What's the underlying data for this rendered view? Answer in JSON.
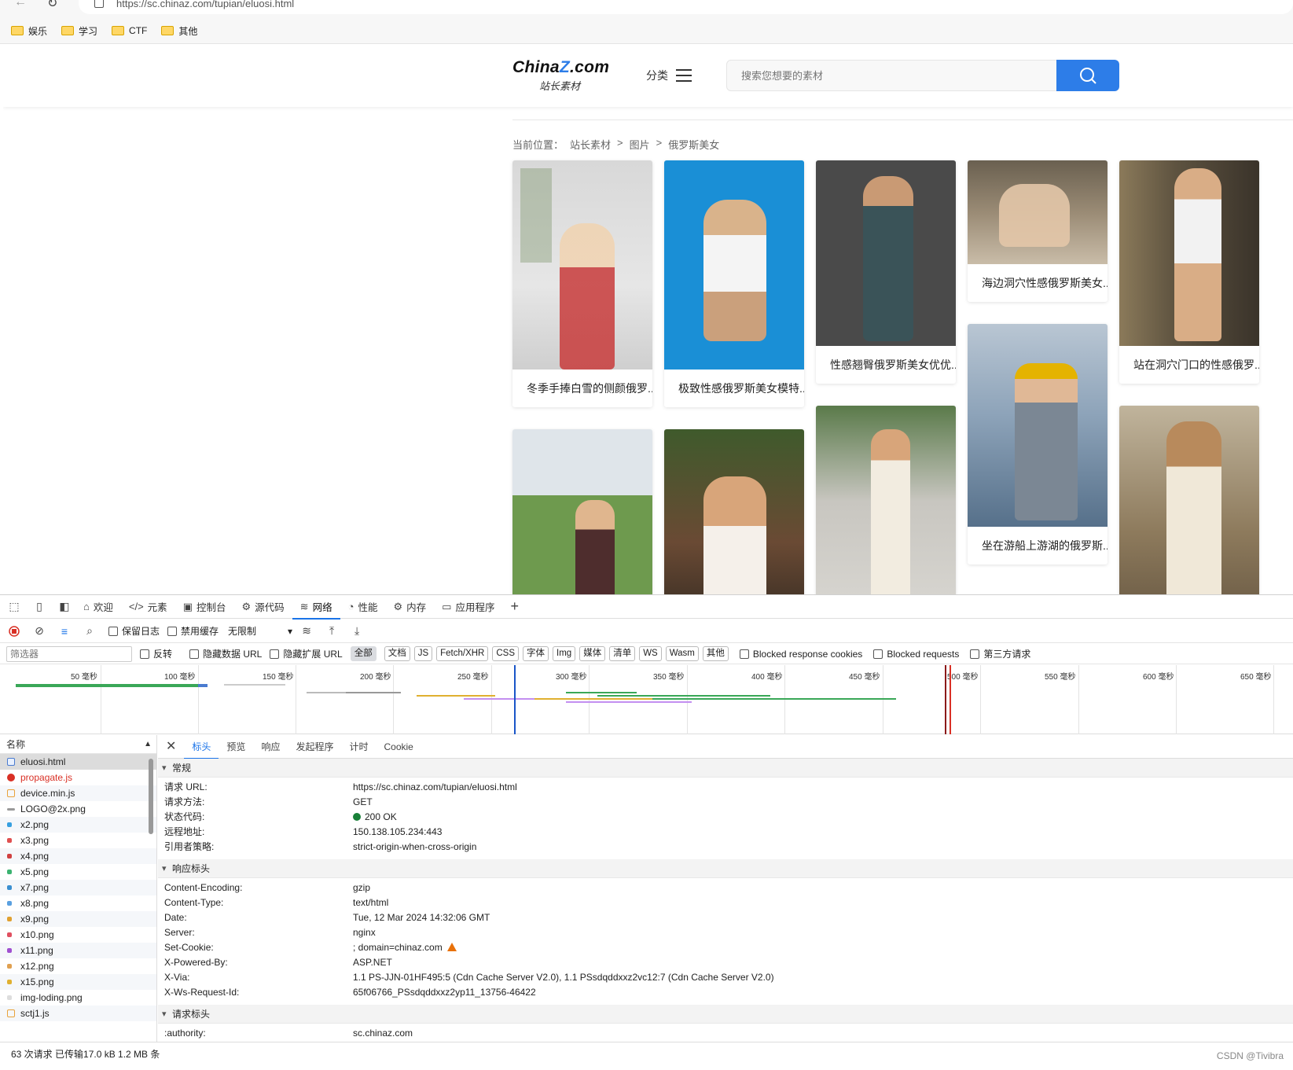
{
  "browser": {
    "url": "https://sc.chinaz.com/tupian/eluosi.html",
    "bookmarks": [
      {
        "label": "娱乐"
      },
      {
        "label": "学习"
      },
      {
        "label": "CTF"
      },
      {
        "label": "其他"
      }
    ]
  },
  "site": {
    "logo_main_a": "China",
    "logo_main_z": "Z",
    "logo_main_b": ".com",
    "logo_sub": "站长素材",
    "category_label": "分类",
    "search_placeholder": "搜索您想要的素材",
    "breadcrumb": {
      "prefix": "当前位置：",
      "items": [
        "站长素材",
        ">",
        "图片",
        ">",
        "俄罗斯美女"
      ]
    },
    "cards": [
      {
        "caption": "冬季手捧白雪的侧颜俄罗..."
      },
      {
        "caption": "极致性感俄罗斯美女模特..."
      },
      {
        "caption": "性感翘臀俄罗斯美女优优..."
      },
      {
        "caption": "海边洞穴性感俄罗斯美女..."
      },
      {
        "caption": "站在洞穴门口的性感俄罗..."
      },
      {
        "caption": "坐在游船上游湖的俄罗斯..."
      }
    ]
  },
  "devtools": {
    "tabs": [
      {
        "label": "欢迎",
        "icon": "home-icon"
      },
      {
        "label": "元素",
        "icon": "code-icon"
      },
      {
        "label": "控制台",
        "icon": "console-icon"
      },
      {
        "label": "源代码",
        "icon": "sources-icon"
      },
      {
        "label": "网络",
        "icon": "wifi-icon"
      },
      {
        "label": "性能",
        "icon": "performance-icon"
      },
      {
        "label": "内存",
        "icon": "memory-icon"
      },
      {
        "label": "应用程序",
        "icon": "application-icon"
      }
    ],
    "toolbar": {
      "preserve_log": "保留日志",
      "disable_cache": "禁用缓存",
      "throttle": "无限制"
    },
    "filter": {
      "placeholder": "筛选器",
      "invert": "反转",
      "hide_data_url": "隐藏数据 URL",
      "hide_ext_url": "隐藏扩展 URL",
      "types": [
        "全部",
        "文档",
        "JS",
        "Fetch/XHR",
        "CSS",
        "字体",
        "Img",
        "媒体",
        "清单",
        "WS",
        "Wasm",
        "其他"
      ],
      "blocked_cookies": "Blocked response cookies",
      "blocked_requests": "Blocked requests",
      "third_party": "第三方请求"
    },
    "timeline_ticks": [
      "50 毫秒",
      "100 毫秒",
      "150 毫秒",
      "200 毫秒",
      "250 毫秒",
      "300 毫秒",
      "350 毫秒",
      "400 毫秒",
      "450 毫秒",
      "500 毫秒",
      "550 毫秒",
      "600 毫秒",
      "650 毫秒"
    ],
    "name_header": "名称",
    "requests": [
      {
        "name": "eluosi.html",
        "color": "#4a7bd0"
      },
      {
        "name": "propagate.js",
        "color": "#d93025"
      },
      {
        "name": "device.min.js",
        "color": "#e8a23a"
      },
      {
        "name": "LOGO@2x.png",
        "color": "#999999"
      },
      {
        "name": "x2.png",
        "color": "#38a0e0"
      },
      {
        "name": "x3.png",
        "color": "#e05050"
      },
      {
        "name": "x4.png",
        "color": "#d04040"
      },
      {
        "name": "x5.png",
        "color": "#3cb371"
      },
      {
        "name": "x7.png",
        "color": "#3a8fd0"
      },
      {
        "name": "x8.png",
        "color": "#5aa0e0"
      },
      {
        "name": "x9.png",
        "color": "#e0a030"
      },
      {
        "name": "x10.png",
        "color": "#e05060"
      },
      {
        "name": "x11.png",
        "color": "#a050d0"
      },
      {
        "name": "x12.png",
        "color": "#e0a050"
      },
      {
        "name": "x15.png",
        "color": "#e0b030"
      },
      {
        "name": "img-loding.png",
        "color": "#cccccc"
      },
      {
        "name": "sctj1.js",
        "color": "#e8a23a"
      }
    ],
    "detail_tabs": [
      "标头",
      "预览",
      "响应",
      "发起程序",
      "计时",
      "Cookie"
    ],
    "general_title": "常规",
    "general": [
      {
        "k": "请求 URL:",
        "v": "https://sc.chinaz.com/tupian/eluosi.html"
      },
      {
        "k": "请求方法:",
        "v": "GET"
      },
      {
        "k": "状态代码:",
        "v": "200 OK"
      },
      {
        "k": "远程地址:",
        "v": "150.138.105.234:443"
      },
      {
        "k": "引用者策略:",
        "v": "strict-origin-when-cross-origin"
      }
    ],
    "response_title": "响应标头",
    "response_headers": [
      {
        "k": "Content-Encoding:",
        "v": "gzip"
      },
      {
        "k": "Content-Type:",
        "v": "text/html"
      },
      {
        "k": "Date:",
        "v": "Tue, 12 Mar 2024 14:32:06 GMT"
      },
      {
        "k": "Server:",
        "v": "nginx"
      },
      {
        "k": "Set-Cookie:",
        "v": "; domain=chinaz.com"
      },
      {
        "k": "X-Powered-By:",
        "v": "ASP.NET"
      },
      {
        "k": "X-Via:",
        "v": "1.1 PS-JJN-01HF495:5 (Cdn Cache Server V2.0), 1.1 PSsdqddxxz2vc12:7 (Cdn Cache Server V2.0)"
      },
      {
        "k": "X-Ws-Request-Id:",
        "v": "65f06766_PSsdqddxxz2yp11_13756-46422"
      }
    ],
    "request_title": "请求标头",
    "request_headers": [
      {
        "k": ":authority:",
        "v": "sc.chinaz.com"
      }
    ],
    "status_bar": "63 次请求  已传输17.0 kB  1.2 MB 条",
    "watermark": "CSDN @Tivibra"
  }
}
